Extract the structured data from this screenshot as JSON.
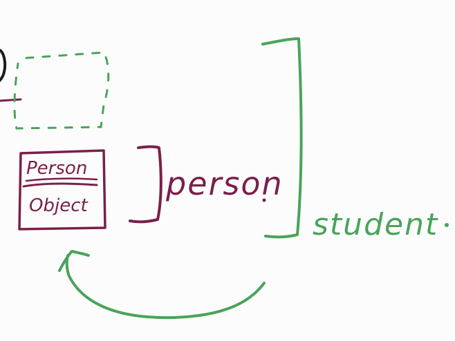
{
  "labels": {
    "box_top": "Person",
    "box_bottom": "Object",
    "person": "person",
    "student": "student"
  },
  "colors": {
    "green": "#4aa35a",
    "maroon": "#7a1f4a",
    "ink": "#1c1c1c",
    "background": "#fcfcfc"
  }
}
